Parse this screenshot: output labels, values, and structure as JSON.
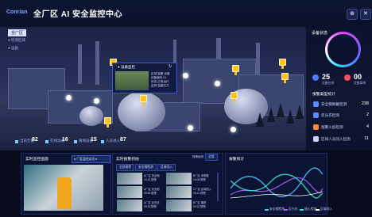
{
  "header": {
    "logo": "Conrian",
    "title": "全厂区 AI 安全监控中心",
    "btn_a": "⊕",
    "btn_b": "✕"
  },
  "left_tree": {
    "factory_button": "全厂区",
    "items": [
      "● 检测区域",
      "● 设备"
    ]
  },
  "popup": {
    "title": "● 设备监控",
    "lines": [
      "区域 装置 设备",
      "设备编码 01",
      "状态 正常运行",
      "监测 温度压力"
    ]
  },
  "stats": [
    {
      "label": "当前告警",
      "value": "82"
    },
    {
      "label": "在线设备",
      "value": "16"
    },
    {
      "label": "离线设备",
      "value": "15"
    },
    {
      "label": "人员进入",
      "value": "87"
    }
  ],
  "right_panel": {
    "title": "设备状态",
    "counters": [
      {
        "value": "25",
        "label": "设备在线",
        "color": "#4c7dff"
      },
      {
        "value": "00",
        "label": "设备离线",
        "color": "#ff4c5a"
      }
    ],
    "list_title": "报警类型统计",
    "items": [
      {
        "label": "安全帽佩戴检测",
        "value": "238",
        "color": "#5b8cff"
      },
      {
        "label": "反光衣检测",
        "value": "2",
        "color": "#5b8cff"
      },
      {
        "label": "烟雾火焰检测",
        "value": "4",
        "color": "#ff8b2e"
      },
      {
        "label": "区域人员闯入检测",
        "value": "11",
        "color": "#c9d6ff"
      }
    ]
  },
  "video_panel": {
    "title": "实时监控画面",
    "combo": "● 厂区监控点位 ▾"
  },
  "alarm_panel": {
    "title": "实时报警抓拍",
    "tabs": [
      "全部报警",
      "安全帽检测",
      "区域闯入"
    ],
    "thumbs": [
      {
        "t1": "A厂区 安全帽",
        "t2": "10:12 报警"
      },
      {
        "t1": "B厂区 未佩戴",
        "t2": "10:08 报警"
      },
      {
        "t1": "A厂区 安全帽",
        "t2": "09:55 报警"
      },
      {
        "t1": "C厂区 区域闯入",
        "t2": "09:41 报警"
      },
      {
        "t1": "A厂区 反光衣",
        "t2": "09:30 报警"
      },
      {
        "t1": "B厂区 烟雾",
        "t2": "09:22 报警"
      }
    ],
    "filter_label": "报警级别",
    "filter_value": "全部"
  },
  "trend_panel": {
    "title": "报警统计",
    "legend": [
      {
        "name": "安全帽检测",
        "color": "#4ec3ff"
      },
      {
        "name": "反光衣",
        "color": "#a45cff"
      },
      {
        "name": "烟火检测",
        "color": "#2ee8c4"
      },
      {
        "name": "区域闯入",
        "color": "#ffffff"
      }
    ]
  }
}
